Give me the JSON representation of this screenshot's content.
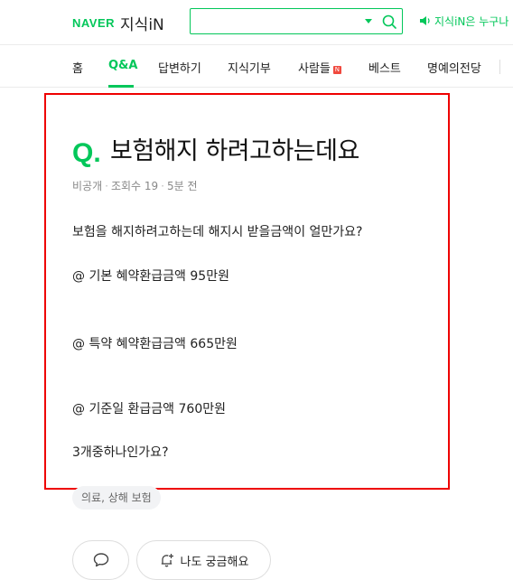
{
  "header": {
    "logo_brand": "NAVER",
    "logo_service": "지식iN",
    "search": {
      "value": "",
      "placeholder": ""
    },
    "ticker_text": "지식iN은 누구나"
  },
  "nav": {
    "items": [
      {
        "label": "홈"
      },
      {
        "label": "Q&A",
        "active": true
      },
      {
        "label": "답변하기"
      },
      {
        "label": "지식기부"
      },
      {
        "label": "사람들",
        "badge": "N"
      },
      {
        "label": "베스트"
      },
      {
        "label": "명예의전당"
      }
    ]
  },
  "question": {
    "mark": "Q.",
    "title": "보험해지 하려고하는데요",
    "meta": {
      "visibility": "비공개",
      "views": "조회수 19",
      "time": "5분 전"
    },
    "body": [
      "보험을 해지하려고하는데 해지시 받을금액이 얼만가요?",
      "@ 기본 혜약환급금액 95만원",
      "@ 특약 혜약환급금액 665만원",
      "@ 기준일 환급금액 760만원",
      "3개중하나인가요?"
    ],
    "tag": "의료, 상해 보험"
  },
  "actions": {
    "curious_label": "나도 궁금해요"
  },
  "colors": {
    "brand_green": "#03c75a",
    "highlight_red": "#e00000"
  }
}
